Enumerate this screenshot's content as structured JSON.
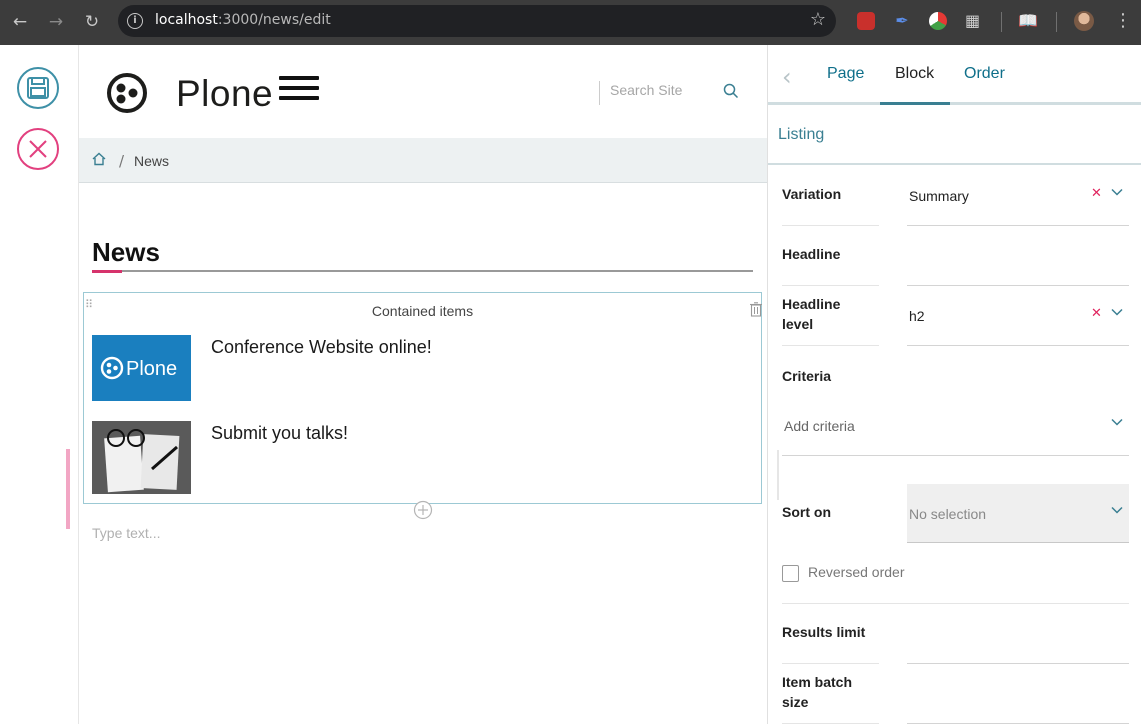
{
  "browser": {
    "url_host": "localhost",
    "url_path": ":3000/news/edit"
  },
  "header": {
    "logo_text": "Plone",
    "search_placeholder": "Search Site"
  },
  "breadcrumb": {
    "items": [
      "News"
    ]
  },
  "page": {
    "title": "News",
    "block_label": "Contained items",
    "items": [
      {
        "title": "Conference Website online!"
      },
      {
        "title": "Submit you talks!"
      }
    ],
    "type_text_placeholder": "Type text..."
  },
  "sidebar": {
    "tabs": [
      "Page",
      "Block",
      "Order"
    ],
    "active_tab": "Block",
    "panel_title": "Listing",
    "fields": {
      "variation": {
        "label": "Variation",
        "value": "Summary"
      },
      "headline": {
        "label": "Headline",
        "value": ""
      },
      "headline_level": {
        "label_line1": "Headline",
        "label_line2": "level",
        "value": "h2"
      },
      "criteria": {
        "label": "Criteria",
        "placeholder": "Add criteria"
      },
      "sort_on": {
        "label": "Sort on",
        "value": "No selection"
      },
      "reversed_order": {
        "label": "Reversed order",
        "checked": false
      },
      "results_limit": {
        "label": "Results limit"
      },
      "item_batch_size": {
        "label_line1": "Item batch",
        "label_line2": "size"
      }
    }
  },
  "colors": {
    "accent_teal": "#3a7f92",
    "link_blue": "#0f6f8a",
    "danger_pink": "#e2407f"
  }
}
